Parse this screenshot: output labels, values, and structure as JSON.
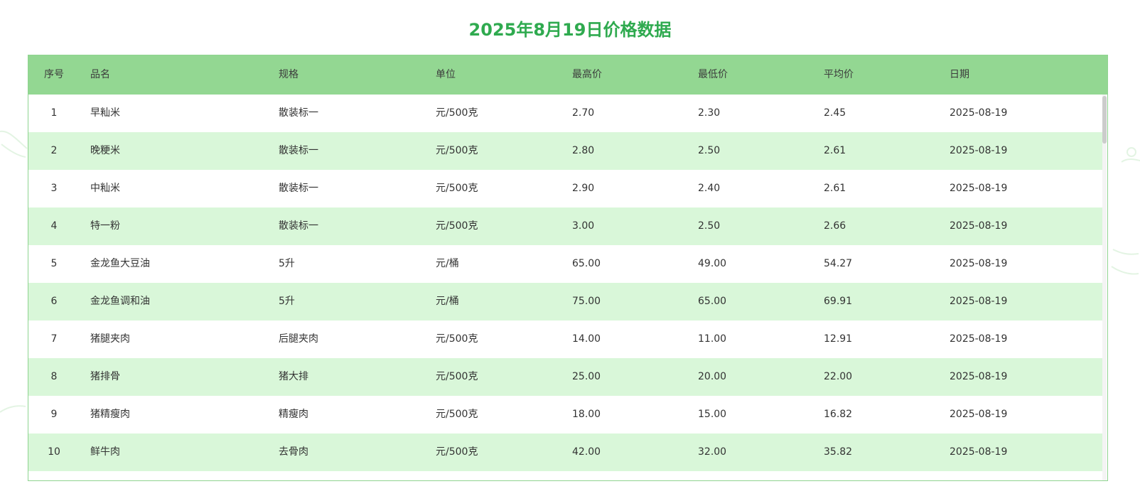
{
  "page": {
    "title": "2025年8月19日价格数据"
  },
  "colors": {
    "title": "#2faa4f",
    "header_bg": "#93d792",
    "row_alt_bg": "#d9f7d9",
    "frame_border": "#8fd490"
  },
  "table": {
    "headers": {
      "index": "序号",
      "name": "品名",
      "spec": "规格",
      "unit": "单位",
      "high": "最高价",
      "low": "最低价",
      "avg": "平均价",
      "date": "日期"
    },
    "rows": [
      {
        "index": "1",
        "name": "早籼米",
        "spec": "散装标一",
        "unit": "元/500克",
        "high": "2.70",
        "low": "2.30",
        "avg": "2.45",
        "date": "2025-08-19"
      },
      {
        "index": "2",
        "name": "晚粳米",
        "spec": "散装标一",
        "unit": "元/500克",
        "high": "2.80",
        "low": "2.50",
        "avg": "2.61",
        "date": "2025-08-19"
      },
      {
        "index": "3",
        "name": "中籼米",
        "spec": "散装标一",
        "unit": "元/500克",
        "high": "2.90",
        "low": "2.40",
        "avg": "2.61",
        "date": "2025-08-19"
      },
      {
        "index": "4",
        "name": "特一粉",
        "spec": "散装标一",
        "unit": "元/500克",
        "high": "3.00",
        "low": "2.50",
        "avg": "2.66",
        "date": "2025-08-19"
      },
      {
        "index": "5",
        "name": "金龙鱼大豆油",
        "spec": "5升",
        "unit": "元/桶",
        "high": "65.00",
        "low": "49.00",
        "avg": "54.27",
        "date": "2025-08-19"
      },
      {
        "index": "6",
        "name": "金龙鱼调和油",
        "spec": "5升",
        "unit": "元/桶",
        "high": "75.00",
        "low": "65.00",
        "avg": "69.91",
        "date": "2025-08-19"
      },
      {
        "index": "7",
        "name": "猪腿夹肉",
        "spec": "后腿夹肉",
        "unit": "元/500克",
        "high": "14.00",
        "low": "11.00",
        "avg": "12.91",
        "date": "2025-08-19"
      },
      {
        "index": "8",
        "name": "猪排骨",
        "spec": "猪大排",
        "unit": "元/500克",
        "high": "25.00",
        "low": "20.00",
        "avg": "22.00",
        "date": "2025-08-19"
      },
      {
        "index": "9",
        "name": "猪精瘦肉",
        "spec": "精瘦肉",
        "unit": "元/500克",
        "high": "18.00",
        "low": "15.00",
        "avg": "16.82",
        "date": "2025-08-19"
      },
      {
        "index": "10",
        "name": "鲜牛肉",
        "spec": "去骨肉",
        "unit": "元/500克",
        "high": "42.00",
        "low": "32.00",
        "avg": "35.82",
        "date": "2025-08-19"
      }
    ]
  }
}
